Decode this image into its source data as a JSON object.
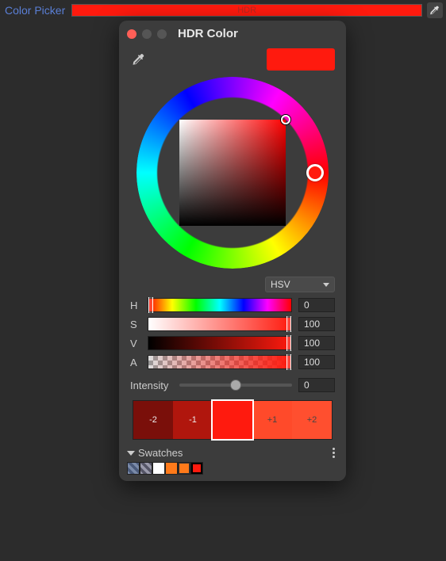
{
  "top": {
    "label": "Color Picker",
    "bar_text": "HDR"
  },
  "window": {
    "title": "HDR Color"
  },
  "current_color": "#ff1a0e",
  "mode": {
    "selected": "HSV"
  },
  "sliders": {
    "h": {
      "label": "H",
      "value": "0"
    },
    "s": {
      "label": "S",
      "value": "100"
    },
    "v": {
      "label": "V",
      "value": "100"
    },
    "a": {
      "label": "A",
      "value": "100"
    }
  },
  "intensity": {
    "label": "Intensity",
    "value": "0"
  },
  "exposure": {
    "cells": [
      {
        "label": "-2",
        "bg": "#7a0f0a",
        "cls": "exp-dark"
      },
      {
        "label": "-1",
        "bg": "#b0160d",
        "cls": "exp-dark"
      },
      {
        "label": "",
        "bg": "#ff1a0e",
        "cls": "exp-dark",
        "selected": true
      },
      {
        "label": "+1",
        "bg": "#ff4a2a",
        "cls": "exp-light"
      },
      {
        "label": "+2",
        "bg": "#ff4f2f",
        "cls": "exp-light"
      }
    ]
  },
  "swatches": {
    "title": "Swatches"
  }
}
